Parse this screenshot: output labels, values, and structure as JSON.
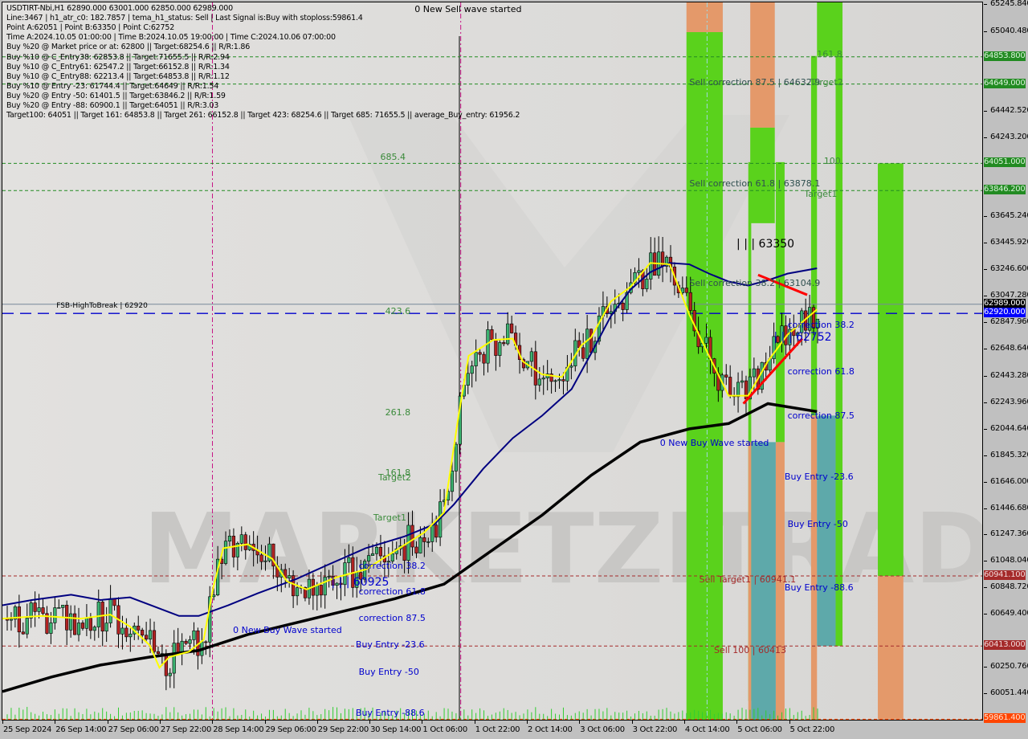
{
  "chart_data": {
    "type": "candlestick",
    "symbol_header": "USDTIRT-Nbi,H1  62890.000 63001.000 62850.000 62989.000",
    "info_lines": [
      "Line:3467 | h1_atr_c0: 182.7857 | tema_h1_status: Sell | Last Signal is:Buy with stoploss:59861.4",
      "Point A:62051 | Point B:63350 | Point C:62752",
      "Time A:2024.10.05 01:00:00 | Time B:2024.10.05 19:00:00 | Time C:2024.10.06 07:00:00",
      "Buy %20 @ Market price or at: 62800 || Target:68254.6 || R/R:1.86",
      "Buy %10 @ C_Entry38: 62853.8 || Target:71655.5 || R/R:2.94",
      "Buy %10 @ C_Entry61: 62547.2 || Target:66152.8 || R/R:1.34",
      "Buy %10 @ C_Entry88: 62213.4 || Target:64853.8 || R/R:1.12",
      "Buy %10 @ Entry -23: 61744.4 || Target:64649 || R/R:1.54",
      "Buy %20 @ Entry -50: 61401.5 || Target:63846.2 || R/R:1.59",
      "Buy %20 @ Entry -88: 60900.1 || Target:64051 || R/R:3.03",
      "Target100: 64051 || Target 161: 64853.8 || Target 261: 66152.8 || Target 423: 68254.6 || Target 685: 71655.5 || average_Buy_entry: 61956.2"
    ],
    "ylim": [
      59850,
      65270
    ],
    "price_ticks": [
      "65245.840",
      "65040.480",
      "64442.520",
      "64243.200",
      "63645.240",
      "63445.920",
      "63246.600",
      "63047.280",
      "62847.960",
      "62648.640",
      "62443.280",
      "62243.960",
      "62044.640",
      "61845.320",
      "61646.000",
      "61446.680",
      "61247.360",
      "61048.040",
      "60848.720",
      "60649.400",
      "60250.760",
      "60051.440"
    ],
    "price_labels": [
      {
        "text": "64853.800",
        "value": 64853.8,
        "bg": "#228b22",
        "fg": "#d9f2d9"
      },
      {
        "text": "64649.000",
        "value": 64649,
        "bg": "#228b22",
        "fg": "#d9f2d9"
      },
      {
        "text": "64051.000",
        "value": 64051,
        "bg": "#228b22",
        "fg": "#d9f2d9"
      },
      {
        "text": "63846.200",
        "value": 63846.2,
        "bg": "#228b22",
        "fg": "#d9f2d9"
      },
      {
        "text": "62989.000",
        "value": 62989,
        "bg": "#000000",
        "fg": "#ffffff"
      },
      {
        "text": "62920.000",
        "value": 62920,
        "bg": "#0000ff",
        "fg": "#ffffff"
      },
      {
        "text": "60941.100",
        "value": 60941.1,
        "bg": "#a52a2a",
        "fg": "#f0d8d8"
      },
      {
        "text": "60413.000",
        "value": 60413,
        "bg": "#a52a2a",
        "fg": "#f0d8d8"
      },
      {
        "text": "59861.400",
        "value": 59861.4,
        "bg": "#ff4500",
        "fg": "#ffe0d0"
      }
    ],
    "time_ticks": [
      "25 Sep 2024",
      "26 Sep 14:00",
      "27 Sep 06:00",
      "27 Sep 22:00",
      "28 Sep 14:00",
      "29 Sep 06:00",
      "29 Sep 22:00",
      "30 Sep 14:00",
      "1 Oct 06:00",
      "1 Oct 22:00",
      "2 Oct 14:00",
      "3 Oct 06:00",
      "3 Oct 22:00",
      "4 Oct 14:00",
      "5 Oct 06:00",
      "5 Oct 22:00"
    ],
    "hlines": [
      {
        "name": "target-161-line",
        "value": 64853.8,
        "color": "#228b22",
        "style": "dash"
      },
      {
        "name": "target-2-line",
        "value": 64649,
        "color": "#228b22",
        "style": "dash"
      },
      {
        "name": "target-100-line",
        "value": 64051,
        "color": "#228b22",
        "style": "dash"
      },
      {
        "name": "target-1-line",
        "value": 63846.2,
        "color": "#228b22",
        "style": "dash"
      },
      {
        "name": "last-price-line",
        "value": 62989,
        "color": "#778899",
        "style": "solid"
      },
      {
        "name": "fsb-high-to-break-line",
        "value": 62920,
        "color": "#0000cd",
        "style": "longdash"
      },
      {
        "name": "sell-target1-line",
        "value": 60941.1,
        "color": "#a52a2a",
        "style": "dash"
      },
      {
        "name": "sell-100-line",
        "value": 60413,
        "color": "#a52a2a",
        "style": "dash"
      },
      {
        "name": "stoploss-line",
        "value": 59861.4,
        "color": "#ff4500",
        "style": "dash"
      }
    ],
    "text_labels": [
      {
        "text": "0 New Sell wave started",
        "xf": 0.42,
        "value": 65210,
        "color": "#000000"
      },
      {
        "text": "FSB-HighToBreak | 62920",
        "xf": 0.055,
        "value": 62975,
        "color": "#000000",
        "size": 9
      },
      {
        "text": "685.4",
        "xf": 0.385,
        "value": 64100,
        "color": "#3a8a3a"
      },
      {
        "text": "423.6",
        "xf": 0.39,
        "value": 62935,
        "color": "#3a8a3a"
      },
      {
        "text": "261.8",
        "xf": 0.39,
        "value": 62170,
        "color": "#3a8a3a"
      },
      {
        "text": "161.8",
        "xf": 0.39,
        "value": 61720,
        "color": "#3a8a3a"
      },
      {
        "text": "Target2",
        "xf": 0.383,
        "value": 61680,
        "color": "#3a8a3a"
      },
      {
        "text": "Target1",
        "xf": 0.378,
        "value": 61380,
        "color": "#3a8a3a"
      },
      {
        "text": "0 New Buy Wave started",
        "xf": 0.235,
        "value": 60530,
        "color": "#0000cd"
      },
      {
        "text": "| | | 60925",
        "xf": 0.335,
        "value": 60890,
        "color": "#0000cd",
        "size": 14
      },
      {
        "text": "correction 38.2",
        "xf": 0.363,
        "value": 61015,
        "color": "#0000cd"
      },
      {
        "text": "correction 61.8",
        "xf": 0.363,
        "value": 60820,
        "color": "#0000cd"
      },
      {
        "text": "correction 87.5",
        "xf": 0.363,
        "value": 60625,
        "color": "#0000cd"
      },
      {
        "text": "Buy Entry -23.6",
        "xf": 0.36,
        "value": 60425,
        "color": "#0000cd"
      },
      {
        "text": "Buy Entry -50",
        "xf": 0.363,
        "value": 60220,
        "color": "#0000cd"
      },
      {
        "text": "Buy Entry -88.6",
        "xf": 0.36,
        "value": 59910,
        "color": "#0000cd"
      },
      {
        "text": "Sell correction 87.5 | 64632.9",
        "xf": 0.7,
        "value": 64660,
        "color": "#2f4f4f"
      },
      {
        "text": "161.8",
        "xf": 0.83,
        "value": 64870,
        "color": "#3a8a3a"
      },
      {
        "text": "Target2",
        "xf": 0.823,
        "value": 64660,
        "color": "#3a8a3a"
      },
      {
        "text": "100",
        "xf": 0.837,
        "value": 64070,
        "color": "#3a8a3a"
      },
      {
        "text": "Sell correction 61.8 | 63878.1",
        "xf": 0.7,
        "value": 63900,
        "color": "#2f4f4f"
      },
      {
        "text": "Target1",
        "xf": 0.817,
        "value": 63820,
        "color": "#3a8a3a"
      },
      {
        "text": "| | | 63350",
        "xf": 0.748,
        "value": 63440,
        "color": "#000000",
        "size": 14
      },
      {
        "text": "Sell correction 38.2 | 63104.9",
        "xf": 0.7,
        "value": 63150,
        "color": "#2f4f4f"
      },
      {
        "text": "correction 38.2",
        "xf": 0.8,
        "value": 62830,
        "color": "#0000cd"
      },
      {
        "text": "| | | 62752",
        "xf": 0.786,
        "value": 62735,
        "color": "#0000cd",
        "size": 14
      },
      {
        "text": "correction 61.8",
        "xf": 0.8,
        "value": 62480,
        "color": "#0000cd"
      },
      {
        "text": "correction 87.5",
        "xf": 0.8,
        "value": 62150,
        "color": "#0000cd"
      },
      {
        "text": "0 New Buy Wave started",
        "xf": 0.67,
        "value": 61940,
        "color": "#0000cd"
      },
      {
        "text": "Buy Entry -23.6",
        "xf": 0.797,
        "value": 61690,
        "color": "#0000cd"
      },
      {
        "text": "Buy Entry -50",
        "xf": 0.8,
        "value": 61330,
        "color": "#0000cd"
      },
      {
        "text": "Buy Entry -88.6",
        "xf": 0.797,
        "value": 60850,
        "color": "#0000cd"
      },
      {
        "text": "Sell Target1 | 60941.1",
        "xf": 0.71,
        "value": 60915,
        "color": "#a52a2a"
      },
      {
        "text": "Sell 100 | 60413",
        "xf": 0.725,
        "value": 60380,
        "color": "#a52a2a"
      }
    ],
    "zones": [
      {
        "name": "green-zone",
        "x0f": 0.697,
        "x1f": 0.734,
        "from": 59440,
        "to": 65040,
        "color": "#5ad21c"
      },
      {
        "name": "orange-zone",
        "x0f": 0.697,
        "x1f": 0.734,
        "from": 65040,
        "to": 65300,
        "color": "#e4996a"
      },
      {
        "name": "orange-zone",
        "x0f": 0.762,
        "x1f": 0.787,
        "from": 64320,
        "to": 65300,
        "color": "#e4996a"
      },
      {
        "name": "green-zone",
        "x0f": 0.762,
        "x1f": 0.787,
        "from": 63600,
        "to": 64320,
        "color": "#5ad21c"
      },
      {
        "name": "green-zone",
        "x0f": 0.76,
        "x1f": 0.763,
        "from": 60000,
        "to": 64060,
        "color": "#5ad21c"
      },
      {
        "name": "orange-zone",
        "x0f": 0.76,
        "x1f": 0.763,
        "from": 59850,
        "to": 61950,
        "color": "#e4996a"
      },
      {
        "name": "teal-zone",
        "x0f": 0.763,
        "x1f": 0.788,
        "from": 59850,
        "to": 61950,
        "color": "#5ea9aa"
      },
      {
        "name": "green-zone",
        "x0f": 0.788,
        "x1f": 0.797,
        "from": 61950,
        "to": 64060,
        "color": "#5ad21c"
      },
      {
        "name": "orange-zone",
        "x0f": 0.788,
        "x1f": 0.797,
        "from": 59850,
        "to": 61950,
        "color": "#e4996a"
      },
      {
        "name": "green-zone",
        "x0f": 0.824,
        "x1f": 0.83,
        "from": 62150,
        "to": 64860,
        "color": "#5ad21c"
      },
      {
        "name": "orange-zone",
        "x0f": 0.824,
        "x1f": 0.83,
        "from": 59850,
        "to": 62150,
        "color": "#e4996a"
      },
      {
        "name": "teal-zone",
        "x0f": 0.83,
        "x1f": 0.849,
        "from": 60413,
        "to": 62150,
        "color": "#5ea9aa"
      },
      {
        "name": "green-zone",
        "x0f": 0.849,
        "x1f": 0.856,
        "from": 60413,
        "to": 64860,
        "color": "#5ad21c"
      },
      {
        "name": "green-zone",
        "x0f": 0.83,
        "x1f": 0.856,
        "from": 64860,
        "to": 65300,
        "color": "#5ad21c"
      },
      {
        "name": "green-zone",
        "x0f": 0.892,
        "x1f": 0.918,
        "from": 60941,
        "to": 64051,
        "color": "#5ad21c"
      },
      {
        "name": "orange-zone",
        "x0f": 0.892,
        "x1f": 0.918,
        "from": 59861,
        "to": 60941,
        "color": "#e4996a"
      }
    ],
    "vlines": [
      {
        "name": "time-a-vline",
        "xf": 0.214,
        "color": "#c71585"
      },
      {
        "name": "sell-wave-vline",
        "xf": 0.467,
        "color": "#c71585"
      },
      {
        "name": "cyan-vline",
        "xf": 0.718,
        "color": "#a0d8e0"
      }
    ],
    "ma_series": {
      "navy": [
        [
          0,
          60720
        ],
        [
          0.03,
          60760
        ],
        [
          0.07,
          60800
        ],
        [
          0.1,
          60760
        ],
        [
          0.13,
          60780
        ],
        [
          0.155,
          60710
        ],
        [
          0.18,
          60640
        ],
        [
          0.2,
          60640
        ],
        [
          0.23,
          60720
        ],
        [
          0.26,
          60810
        ],
        [
          0.3,
          60920
        ],
        [
          0.33,
          61020
        ],
        [
          0.37,
          61150
        ],
        [
          0.41,
          61240
        ],
        [
          0.44,
          61330
        ],
        [
          0.46,
          61480
        ],
        [
          0.49,
          61750
        ],
        [
          0.52,
          61980
        ],
        [
          0.55,
          62150
        ],
        [
          0.58,
          62350
        ],
        [
          0.6,
          62620
        ],
        [
          0.62,
          62900
        ],
        [
          0.64,
          63100
        ],
        [
          0.66,
          63230
        ],
        [
          0.68,
          63300
        ],
        [
          0.7,
          63290
        ],
        [
          0.72,
          63220
        ],
        [
          0.74,
          63160
        ],
        [
          0.76,
          63130
        ],
        [
          0.78,
          63170
        ],
        [
          0.8,
          63220
        ],
        [
          0.83,
          63260
        ]
      ],
      "yellow": [
        [
          0,
          60620
        ],
        [
          0.04,
          60640
        ],
        [
          0.08,
          60620
        ],
        [
          0.11,
          60650
        ],
        [
          0.13,
          60560
        ],
        [
          0.15,
          60420
        ],
        [
          0.16,
          60250
        ],
        [
          0.17,
          60330
        ],
        [
          0.19,
          60370
        ],
        [
          0.205,
          60460
        ],
        [
          0.215,
          60860
        ],
        [
          0.225,
          61150
        ],
        [
          0.25,
          61180
        ],
        [
          0.275,
          61070
        ],
        [
          0.29,
          60900
        ],
        [
          0.31,
          60840
        ],
        [
          0.34,
          60930
        ],
        [
          0.37,
          60990
        ],
        [
          0.4,
          61130
        ],
        [
          0.43,
          61270
        ],
        [
          0.45,
          61420
        ],
        [
          0.465,
          62160
        ],
        [
          0.475,
          62600
        ],
        [
          0.5,
          62720
        ],
        [
          0.52,
          62730
        ],
        [
          0.53,
          62560
        ],
        [
          0.55,
          62460
        ],
        [
          0.57,
          62440
        ],
        [
          0.59,
          62680
        ],
        [
          0.6,
          62740
        ],
        [
          0.62,
          63010
        ],
        [
          0.64,
          63120
        ],
        [
          0.66,
          63300
        ],
        [
          0.68,
          63290
        ],
        [
          0.7,
          62910
        ],
        [
          0.72,
          62600
        ],
        [
          0.74,
          62300
        ],
        [
          0.76,
          62300
        ],
        [
          0.78,
          62560
        ],
        [
          0.8,
          62760
        ],
        [
          0.83,
          62950
        ]
      ],
      "black": [
        [
          0,
          60070
        ],
        [
          0.05,
          60180
        ],
        [
          0.1,
          60270
        ],
        [
          0.15,
          60330
        ],
        [
          0.2,
          60380
        ],
        [
          0.25,
          60500
        ],
        [
          0.3,
          60590
        ],
        [
          0.35,
          60680
        ],
        [
          0.4,
          60770
        ],
        [
          0.45,
          60880
        ],
        [
          0.5,
          61140
        ],
        [
          0.55,
          61400
        ],
        [
          0.6,
          61700
        ],
        [
          0.65,
          61950
        ],
        [
          0.7,
          62050
        ],
        [
          0.74,
          62090
        ],
        [
          0.78,
          62240
        ],
        [
          0.83,
          62180
        ]
      ]
    },
    "abc_wedge": [
      [
        0.755,
        62240
      ],
      [
        0.815,
        62730
      ],
      [
        0.77,
        63210
      ],
      [
        0.82,
        63060
      ]
    ],
    "candles_seed": 3467,
    "volume_note": "green volume bars along bottom"
  }
}
